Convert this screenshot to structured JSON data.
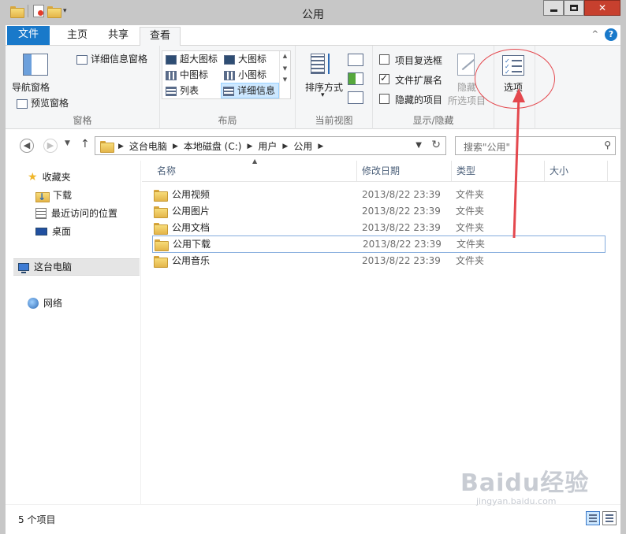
{
  "window": {
    "title": "公用"
  },
  "tabs": [
    {
      "label": "文件"
    },
    {
      "label": "主页"
    },
    {
      "label": "共享"
    },
    {
      "label": "查看"
    }
  ],
  "ribbon": {
    "pane_group": {
      "nav_pane": "导航窗格",
      "preview_pane": "预览窗格",
      "details_pane": "详细信息窗格",
      "label": "窗格"
    },
    "layout_group": {
      "items": [
        "超大图标",
        "大图标",
        "中图标",
        "小图标",
        "列表",
        "详细信息"
      ],
      "label": "布局"
    },
    "current_view_group": {
      "sort_by": "排序方式",
      "label": "当前视图"
    },
    "show_hide_group": {
      "item_checkboxes": "项目复选框",
      "file_extensions": "文件扩展名",
      "hidden_items": "隐藏的项目",
      "hide_line1": "隐藏",
      "hide_line2": "所选项目",
      "label": "显示/隐藏",
      "file_extensions_checked": true
    },
    "options": {
      "label": "选项"
    }
  },
  "address": {
    "crumbs": [
      "这台电脑",
      "本地磁盘 (C:)",
      "用户",
      "公用"
    ],
    "search_placeholder": "搜索\"公用\""
  },
  "navpane": {
    "favorites": "收藏夹",
    "favorites_items": [
      "下载",
      "最近访问的位置",
      "桌面"
    ],
    "this_pc": "这台电脑",
    "network": "网络"
  },
  "columns": [
    "名称",
    "修改日期",
    "类型",
    "大小"
  ],
  "files": [
    {
      "name": "公用视频",
      "date": "2013/8/22 23:39",
      "type": "文件夹"
    },
    {
      "name": "公用图片",
      "date": "2013/8/22 23:39",
      "type": "文件夹"
    },
    {
      "name": "公用文档",
      "date": "2013/8/22 23:39",
      "type": "文件夹"
    },
    {
      "name": "公用下载",
      "date": "2013/8/22 23:39",
      "type": "文件夹"
    },
    {
      "name": "公用音乐",
      "date": "2013/8/22 23:39",
      "type": "文件夹"
    }
  ],
  "status": {
    "count": "5 个项目"
  },
  "watermark": {
    "brand": "Baidu经验",
    "url": "jingyan.baidu.com"
  },
  "colors": {
    "accent": "#1979ca",
    "annotation": "#e4484e",
    "selection": "#cde8ff"
  }
}
